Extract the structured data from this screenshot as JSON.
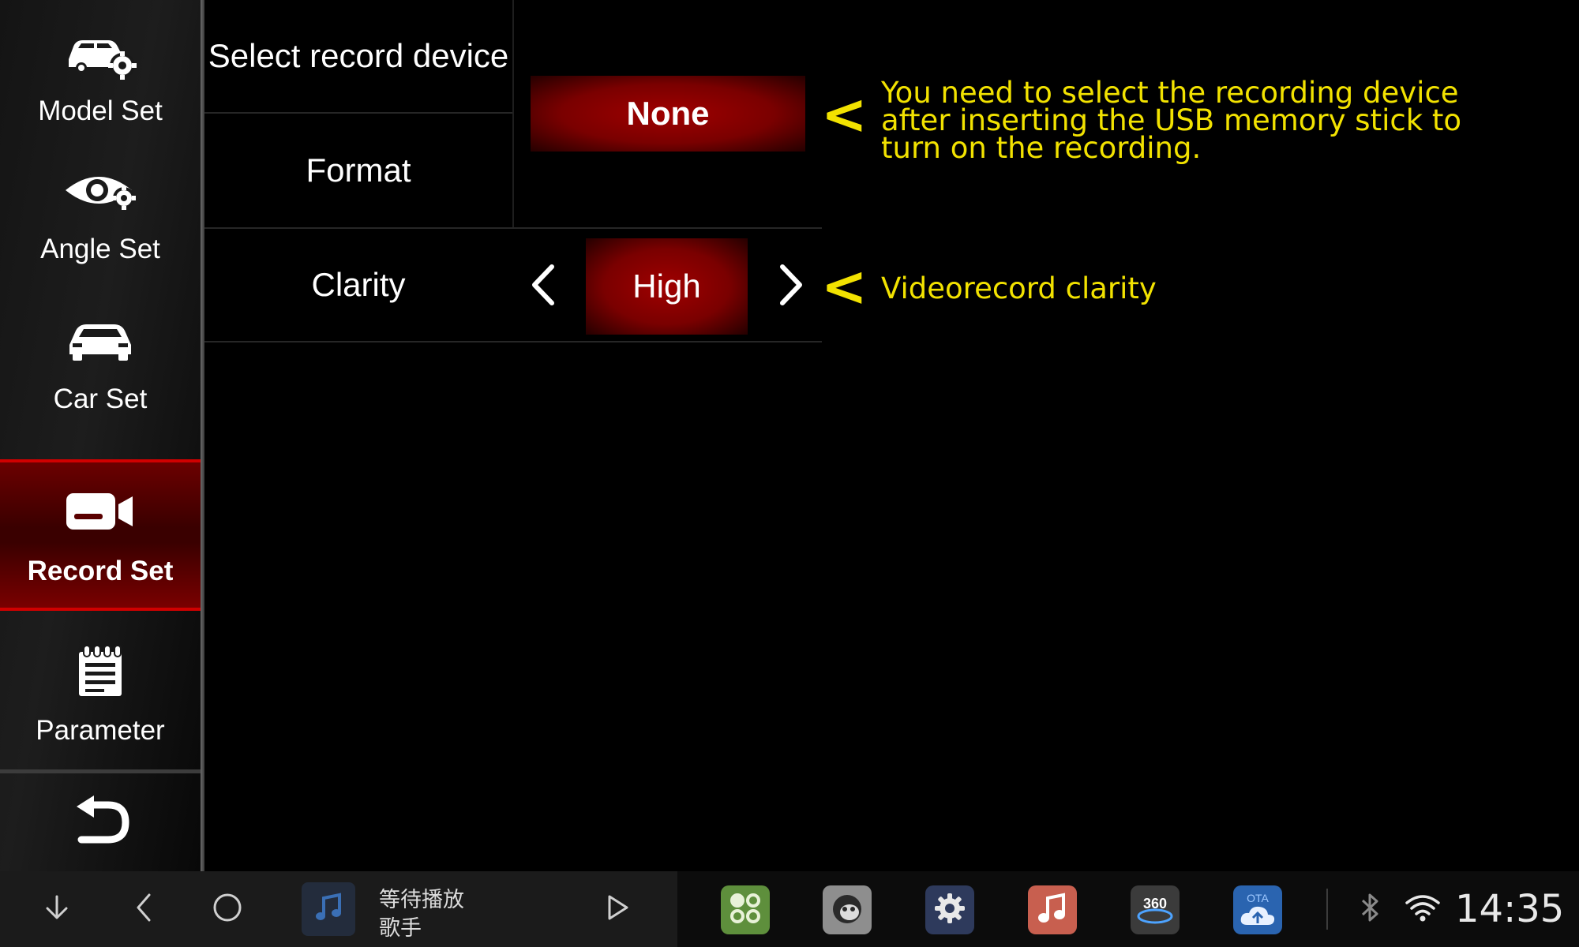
{
  "sidebar": {
    "items": [
      {
        "label": "Model Set",
        "icon": "car-gear-icon"
      },
      {
        "label": "Angle Set",
        "icon": "eye-gear-icon"
      },
      {
        "label": "Car Set",
        "icon": "car-icon"
      },
      {
        "label": "Record Set",
        "icon": "camcorder-icon",
        "active": true
      },
      {
        "label": "Parameter",
        "icon": "notepad-icon"
      }
    ],
    "back_icon": "return-arrow-icon"
  },
  "settings": {
    "select_device": {
      "label": "Select record device",
      "value": "None"
    },
    "format": {
      "label": "Format"
    },
    "clarity": {
      "label": "Clarity",
      "value": "High"
    }
  },
  "notes": {
    "device_note_lines": [
      "You need to select the recording device",
      "after inserting the USB memory stick to",
      "turn on the recording."
    ],
    "clarity_note": "Videorecord clarity",
    "pointer_glyph": "<"
  },
  "bottom_bar": {
    "music_title": "等待播放",
    "music_artist": "歌手",
    "apps": [
      "apps-grid-icon",
      "mascot-icon",
      "settings-gear-icon",
      "music-note-icon",
      "camera-360-icon",
      "ota-cloud-icon"
    ],
    "app_360_label": "360",
    "app_ota_label": "OTA",
    "clock": "14:35"
  },
  "colors": {
    "accent_red": "#a00000",
    "note_yellow": "#f2e200"
  }
}
